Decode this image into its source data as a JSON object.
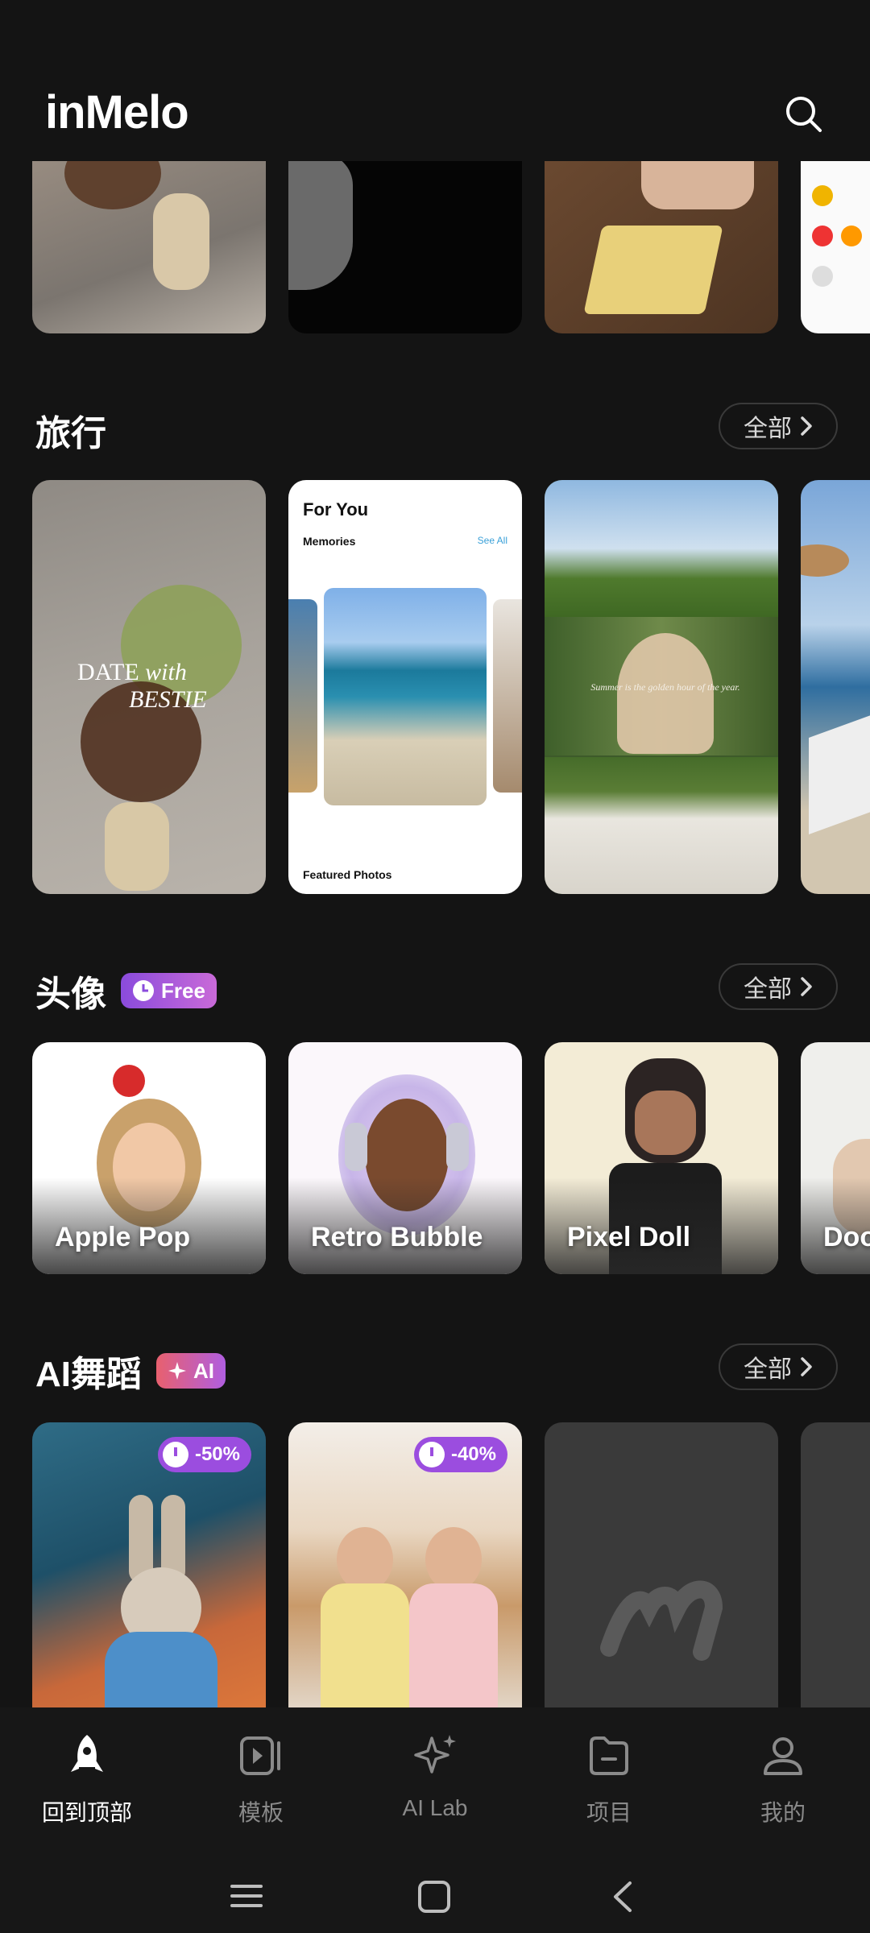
{
  "app": {
    "logo": "inMelo"
  },
  "sections": {
    "travel": {
      "title": "旅行",
      "all_label": "全部"
    },
    "avatar": {
      "title": "头像",
      "badge": "Free",
      "all_label": "全部"
    },
    "ai_dance": {
      "title": "AI舞蹈",
      "badge": "AI",
      "all_label": "全部"
    }
  },
  "travel_cards": {
    "date_line1": "DATE",
    "date_with": "with",
    "date_line2": "BESTIE",
    "for_you": "For You",
    "memories": "Memories",
    "see_all": "See All",
    "featured": "Featured Photos",
    "summer_quote": "Summer is the golden hour of the year."
  },
  "avatar_cards": [
    {
      "label": "Apple Pop"
    },
    {
      "label": "Retro Bubble"
    },
    {
      "label": "Pixel Doll"
    },
    {
      "label": "Doo"
    }
  ],
  "dance_cards": [
    {
      "discount": "-50%"
    },
    {
      "discount": "-40%"
    }
  ],
  "bottom_nav": [
    {
      "label": "回到顶部",
      "icon": "rocket-icon"
    },
    {
      "label": "模板",
      "icon": "template-icon"
    },
    {
      "label": "AI Lab",
      "icon": "sparkle-icon"
    },
    {
      "label": "项目",
      "icon": "folder-icon"
    },
    {
      "label": "我的",
      "icon": "profile-icon"
    }
  ],
  "colors": {
    "background": "#141414",
    "free_badge": "#9b4ddf",
    "ai_badge": "#e0607a",
    "discount": "#9b4ddf"
  }
}
